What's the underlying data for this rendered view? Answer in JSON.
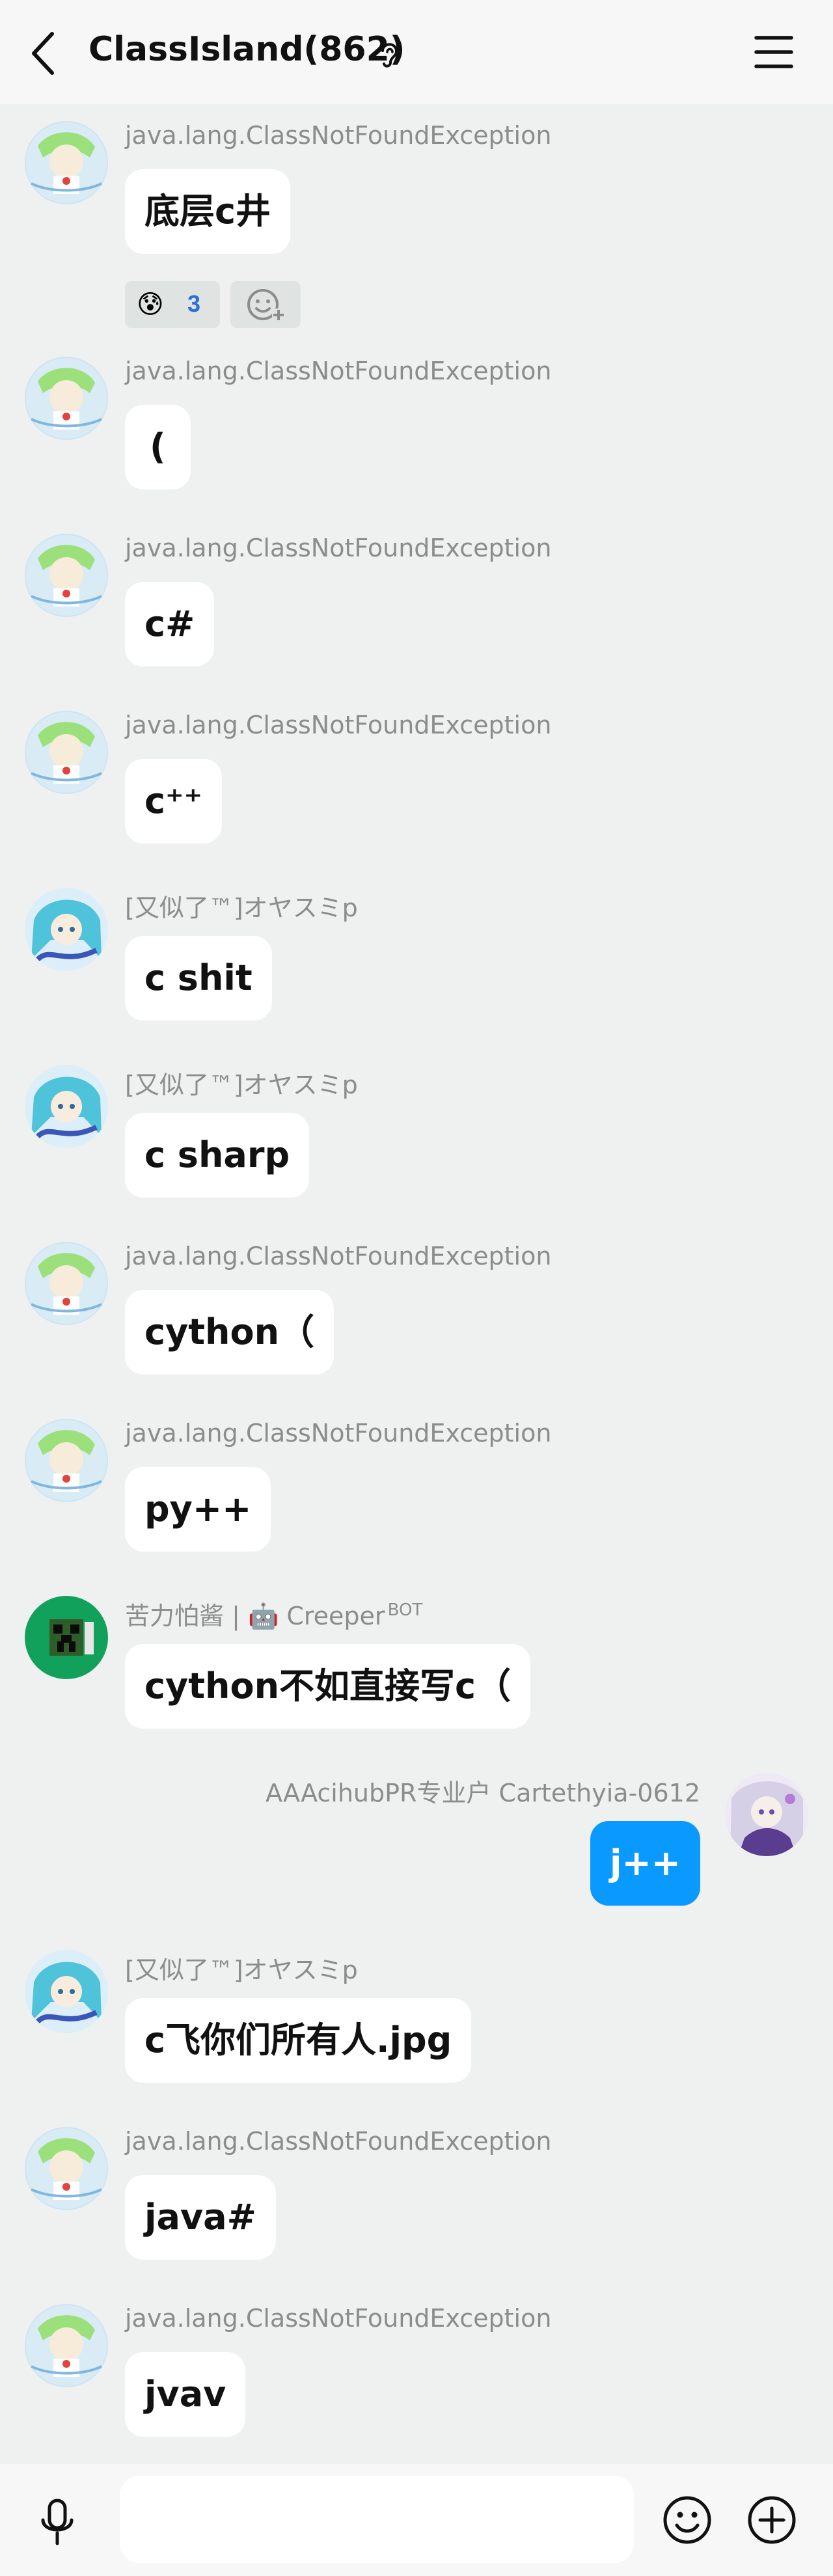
{
  "header": {
    "title": "ClassIsland(862)",
    "back_icon": "chevron-left-icon",
    "ear_icon": "ear-icon",
    "menu_icon": "hamburger-menu-icon"
  },
  "colors": {
    "background": "#eef1f0",
    "header_bg": "#f7f7f7",
    "self_bubble": "#0a99ff",
    "other_bubble": "#ffffff",
    "sender_name": "#8c8c8c",
    "reaction_count": "#2f6fd6"
  },
  "messages": [
    {
      "sender": "java.lang.ClassNotFoundException",
      "text": "底层c井",
      "side": "left",
      "avatar": "anime-girl-green-hair-avatar"
    },
    {
      "sender": "java.lang.ClassNotFoundException",
      "text": "(",
      "side": "left",
      "avatar": "anime-girl-green-hair-avatar"
    },
    {
      "sender": "java.lang.ClassNotFoundException",
      "text": "c#",
      "side": "left",
      "avatar": "anime-girl-green-hair-avatar"
    },
    {
      "sender": "java.lang.ClassNotFoundException",
      "text": "c⁺⁺",
      "side": "left",
      "avatar": "anime-girl-green-hair-avatar"
    },
    {
      "sender": "[又似了™]オヤスミp",
      "text": "c shit",
      "side": "left",
      "avatar": "anime-girl-blue-hair-avatar"
    },
    {
      "sender": "[又似了™]オヤスミp",
      "text": "c sharp",
      "side": "left",
      "avatar": "anime-girl-blue-hair-avatar"
    },
    {
      "sender": "java.lang.ClassNotFoundException",
      "text": "cython（",
      "side": "left",
      "avatar": "anime-girl-green-hair-avatar"
    },
    {
      "sender": "java.lang.ClassNotFoundException",
      "text": "py++",
      "side": "left",
      "avatar": "anime-girl-green-hair-avatar"
    },
    {
      "sender": "苦力怕酱 | 🤖 Creeper",
      "sender_tag": "BOT",
      "text": "cython不如直接写c（",
      "side": "left",
      "avatar": "creeper-avatar"
    },
    {
      "sender": "AAAcihubPR专业户 Cartethyia-0612",
      "text": "j++",
      "side": "right",
      "avatar": "anime-girl-purple-avatar"
    },
    {
      "sender": "[又似了™]オヤスミp",
      "text": "c飞你们所有人.jpg",
      "side": "left",
      "avatar": "anime-girl-blue-hair-avatar"
    },
    {
      "sender": "java.lang.ClassNotFoundException",
      "text": "java#",
      "side": "left",
      "avatar": "anime-girl-green-hair-avatar"
    },
    {
      "sender": "java.lang.ClassNotFoundException",
      "text": "jvav",
      "side": "left",
      "avatar": "anime-girl-green-hair-avatar"
    }
  ],
  "reactions": {
    "emoji": "😰",
    "count": "3",
    "add_icon": "add-reaction-icon"
  },
  "footer": {
    "input_placeholder": "",
    "mic_icon": "microphone-icon",
    "emoji_icon": "smiley-icon",
    "plus_icon": "plus-circle-icon"
  }
}
